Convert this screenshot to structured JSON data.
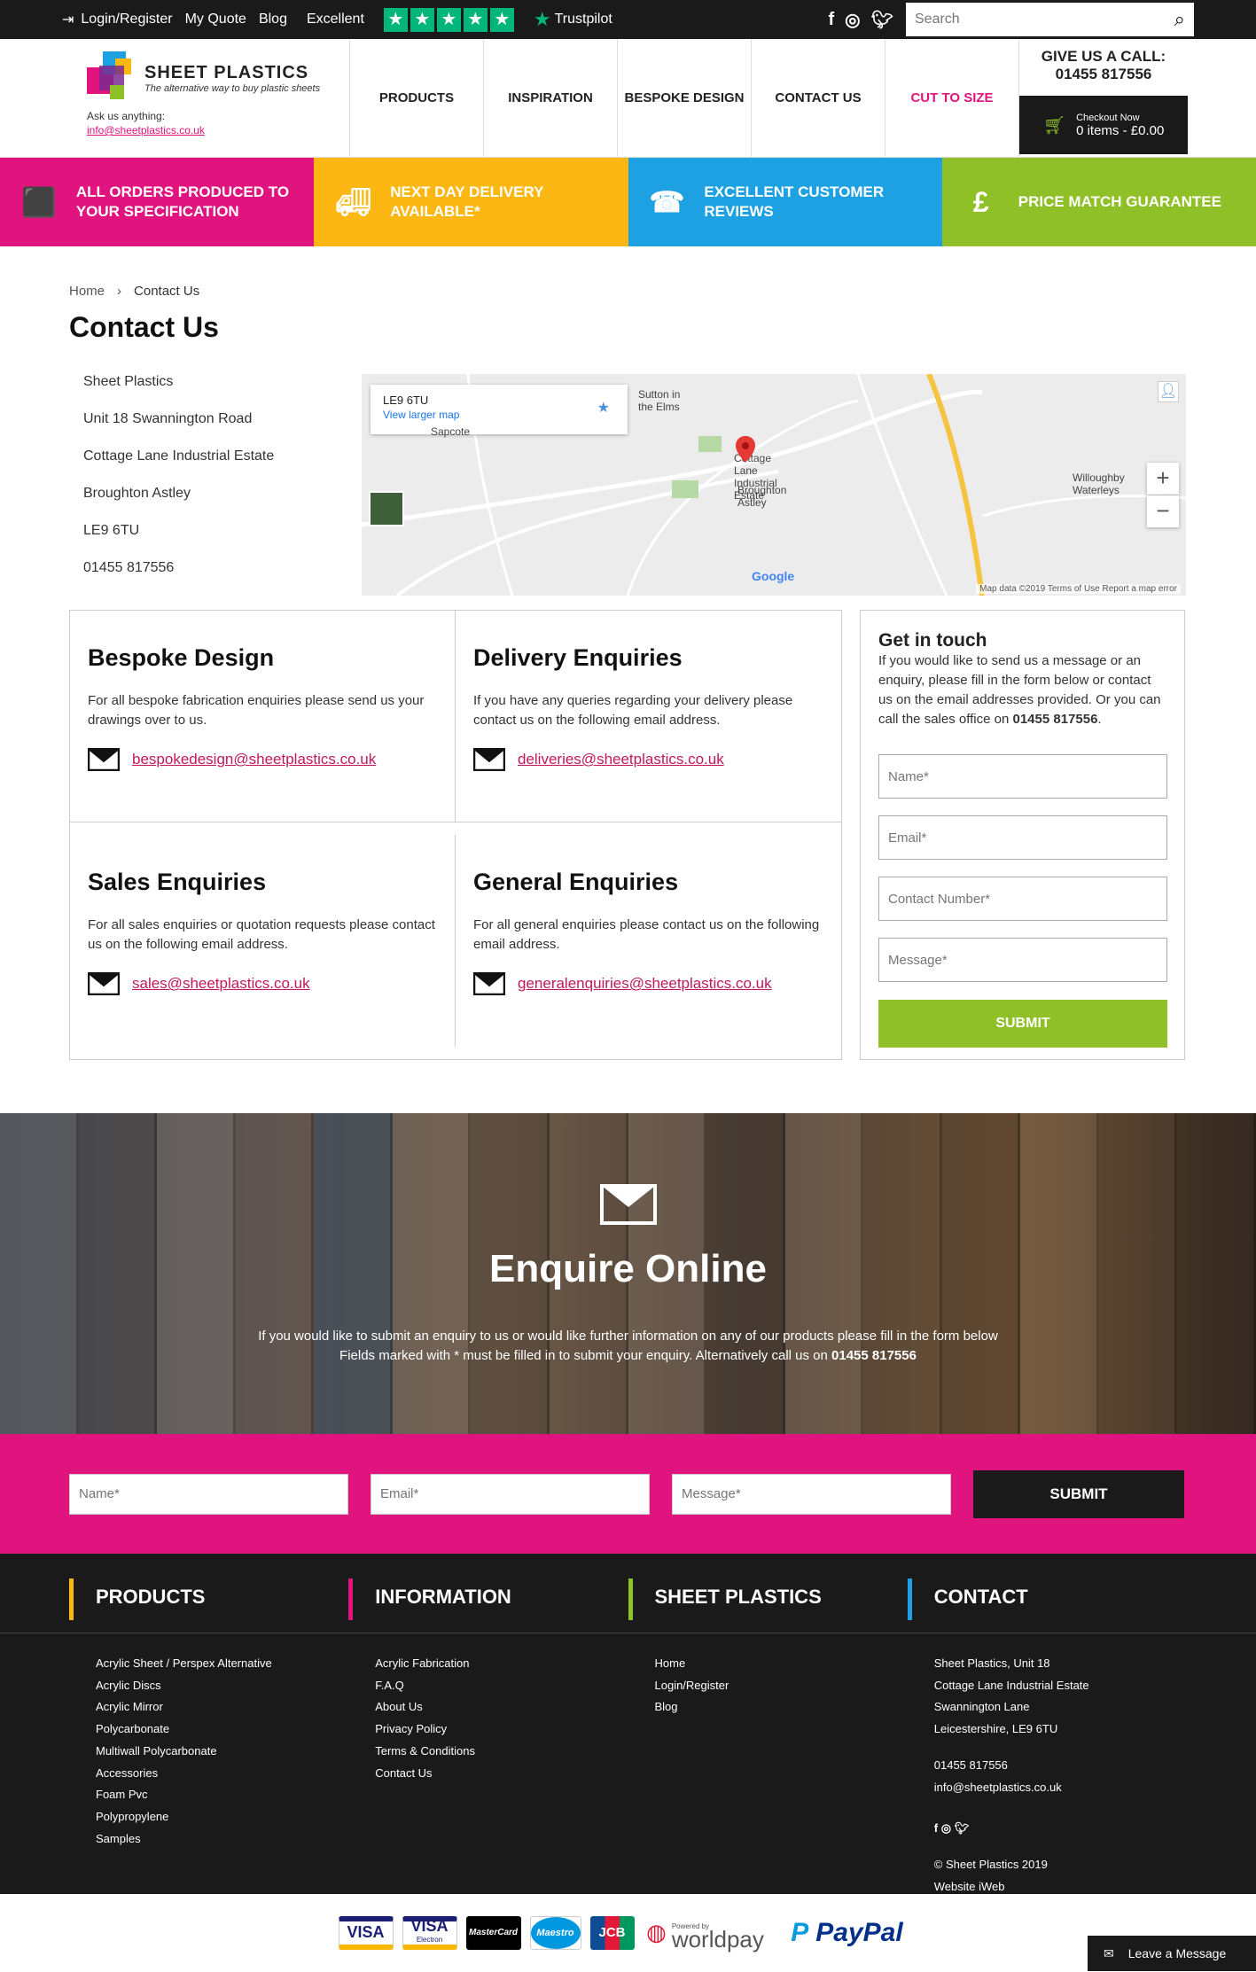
{
  "topbar": {
    "login": "Login/Register",
    "quote": "My Quote",
    "blog": "Blog",
    "rating": "Excellent",
    "trustpilot": "Trustpilot",
    "search_placeholder": "Search"
  },
  "header": {
    "brand": "SHEET PLASTICS",
    "tagline": "The alternative way to buy plastic sheets",
    "ask": "Ask us anything:",
    "ask_email": "info@sheetplastics.co.uk",
    "nav": [
      "PRODUCTS",
      "INSPIRATION",
      "BESPOKE DESIGN",
      "CONTACT US",
      "CUT TO SIZE"
    ],
    "call_label": "GIVE US A CALL:",
    "call_number": "01455 817556",
    "checkout_label": "Checkout Now",
    "checkout_items": "0 items - £0.00"
  },
  "usps": [
    {
      "text": "ALL ORDERS PRODUCED TO YOUR SPECIFICATION",
      "color": "#e0137f",
      "icon": "box-icon"
    },
    {
      "text": "NEXT DAY DELIVERY AVAILABLE*",
      "color": "#fdb713",
      "icon": "truck-icon"
    },
    {
      "text": "EXCELLENT CUSTOMER REVIEWS",
      "color": "#1da1e2",
      "icon": "phone-chat-icon"
    },
    {
      "text": "PRICE MATCH GUARANTEE",
      "color": "#8fc028",
      "icon": "pound-badge-icon"
    }
  ],
  "breadcrumb": {
    "home": "Home",
    "current": "Contact Us"
  },
  "page_title": "Contact Us",
  "address": [
    "Sheet Plastics",
    "Unit 18 Swannington Road",
    "Cottage Lane Industrial Estate",
    "Broughton Astley",
    "LE9 6TU",
    "01455 817556"
  ],
  "map": {
    "postcode": "LE9 6TU",
    "larger": "View larger map",
    "labels": {
      "sutton": "Sutton in the Elms",
      "sapcote": "Sapcote",
      "cottage": "Cottage Lane Industrial Estate",
      "broughton": "Broughton Astley",
      "willoughby": "Willoughby Waterleys",
      "google": "Google"
    },
    "footer": "Map data ©2019   Terms of Use   Report a map error"
  },
  "enquiries": [
    {
      "title": "Bespoke Design",
      "text": "For all bespoke fabrication enquiries please send us your drawings over to us.",
      "email": "bespokedesign@sheetplastics.co.uk"
    },
    {
      "title": "Delivery Enquiries",
      "text": "If you have any queries regarding your delivery please contact us on the following email address.",
      "email": "deliveries@sheetplastics.co.uk"
    },
    {
      "title": "Sales Enquiries",
      "text": "For all sales enquiries or quotation requests please contact us on the following email address.",
      "email": "sales@sheetplastics.co.uk"
    },
    {
      "title": "General Enquiries",
      "text": "For all general enquiries please contact us on the following email address.",
      "email": "generalenquiries@sheetplastics.co.uk"
    }
  ],
  "get_in_touch": {
    "title": "Get in touch",
    "text": "If you would like to send us a message or an enquiry, please fill in the form below or contact us on the email addresses provided. Or you can call the sales office on",
    "phone": "01455 817556",
    "name_ph": "Name*",
    "email_ph": "Email*",
    "contact_ph": "Contact Number*",
    "message_ph": "Message*",
    "submit": "SUBMIT"
  },
  "enquire_online": {
    "title": "Enquire Online",
    "line1": "If you would like to submit an enquiry to us or would like further information on any of our products please fill in the form below",
    "line2": "Fields marked with * must be filled in to submit your enquiry. Alternatively call us on",
    "phone": "01455 817556",
    "name_ph": "Name*",
    "email_ph": "Email*",
    "message_ph": "Message*",
    "submit": "SUBMIT"
  },
  "footer": {
    "products": {
      "title": "PRODUCTS",
      "color": "#fdb713",
      "links": [
        "Acrylic Sheet / Perspex Alternative",
        "Acrylic Discs",
        "Acrylic Mirror",
        "Polycarbonate",
        "Multiwall Polycarbonate",
        "Accessories",
        "Foam Pvc",
        "Polypropylene",
        "Samples"
      ]
    },
    "information": {
      "title": "INFORMATION",
      "color": "#e0137f",
      "links": [
        "Acrylic Fabrication",
        "F.A.Q",
        "About Us",
        "Privacy Policy",
        "Terms & Conditions",
        "Contact Us"
      ]
    },
    "sheetplastics": {
      "title": "SHEET PLASTICS",
      "color": "#8fc028",
      "links": [
        "Home",
        "Login/Register",
        "Blog"
      ]
    },
    "contact": {
      "title": "CONTACT",
      "color": "#1da1e2",
      "addr": [
        "Sheet Plastics, Unit 18",
        "Cottage Lane Industrial Estate",
        "Swannington Lane",
        "Leicestershire, LE9 6TU"
      ],
      "phone": "01455 817556",
      "email": "info@sheetplastics.co.uk",
      "copyright": "© Sheet Plastics 2019",
      "website": "Website iWeb"
    }
  },
  "payments": {
    "visa": "VISA",
    "visa_electron": "VISA",
    "electron": "Electron",
    "mastercard": "MasterCard",
    "maestro": "Maestro",
    "jcb": "JCB",
    "worldpay": "worldpay",
    "worldpay_powered": "Powered by",
    "paypal": "PayPal"
  },
  "leave_message": "Leave a Message"
}
